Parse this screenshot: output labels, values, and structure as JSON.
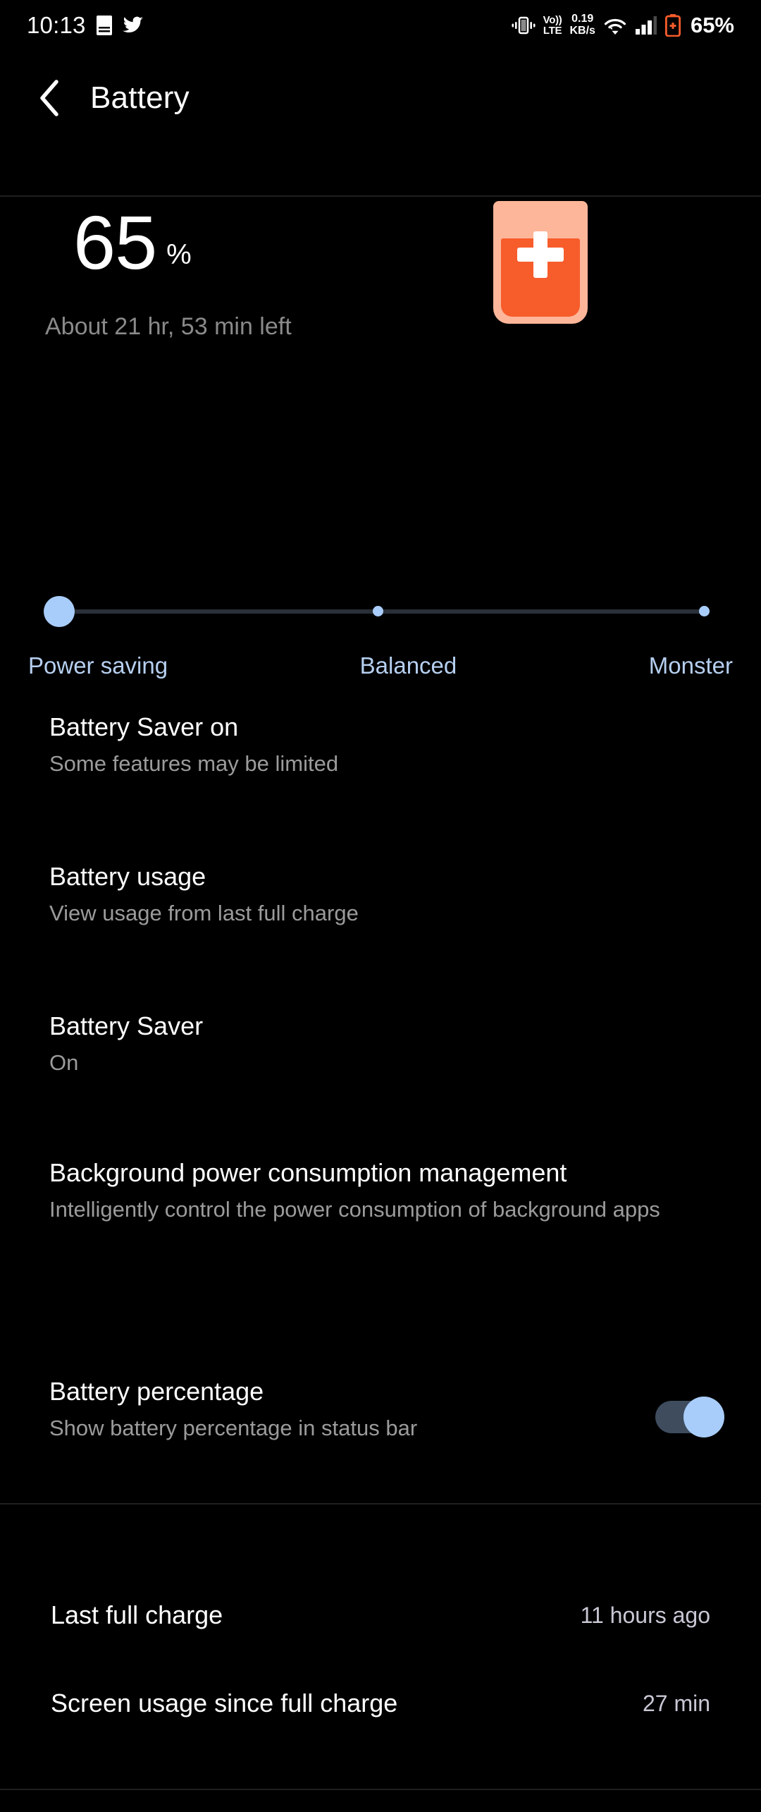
{
  "statusbar": {
    "time": "10:13",
    "icons_left": [
      "notes-icon",
      "twitter-icon"
    ],
    "volte_top": "Vo))",
    "volte_bottom": "LTE",
    "netspeed_value": "0.19",
    "netspeed_unit": "KB/s",
    "icons_right": [
      "vibrate-icon",
      "volte-icon",
      "network-speed",
      "wifi-icon",
      "signal-icon",
      "battery-saver-icon"
    ],
    "battery_percent": "65%"
  },
  "header": {
    "back_icon": "chevron-left-icon",
    "title": "Battery"
  },
  "summary": {
    "percent": "65",
    "percent_symbol": "%",
    "time_remaining": "About 21 hr, 53 min left",
    "battery_icon": "battery-plus-icon",
    "battery_fill_percent": 65,
    "battery_shell_color": "#FDB699",
    "battery_fill_color": "#F75C2B"
  },
  "performance_slider": {
    "value_index": 0,
    "labels": [
      "Power saving",
      "Balanced",
      "Monster"
    ],
    "thumb_color": "#A9CDFA",
    "track_color": "#2a3038"
  },
  "settings": [
    {
      "title": "Battery Saver on",
      "subtitle": "Some features may be limited"
    },
    {
      "title": "Battery usage",
      "subtitle": "View usage from last full charge"
    },
    {
      "title": "Battery Saver",
      "subtitle": "On"
    },
    {
      "title": "Background power consumption management",
      "subtitle": "Intelligently control the power consumption of background apps"
    },
    {
      "title": "Battery percentage",
      "subtitle": "Show battery percentage in status bar",
      "toggle_state": "on"
    }
  ],
  "stats": [
    {
      "label": "Last full charge",
      "value": "11 hours ago"
    },
    {
      "label": "Screen usage since full charge",
      "value": "27 min"
    }
  ]
}
